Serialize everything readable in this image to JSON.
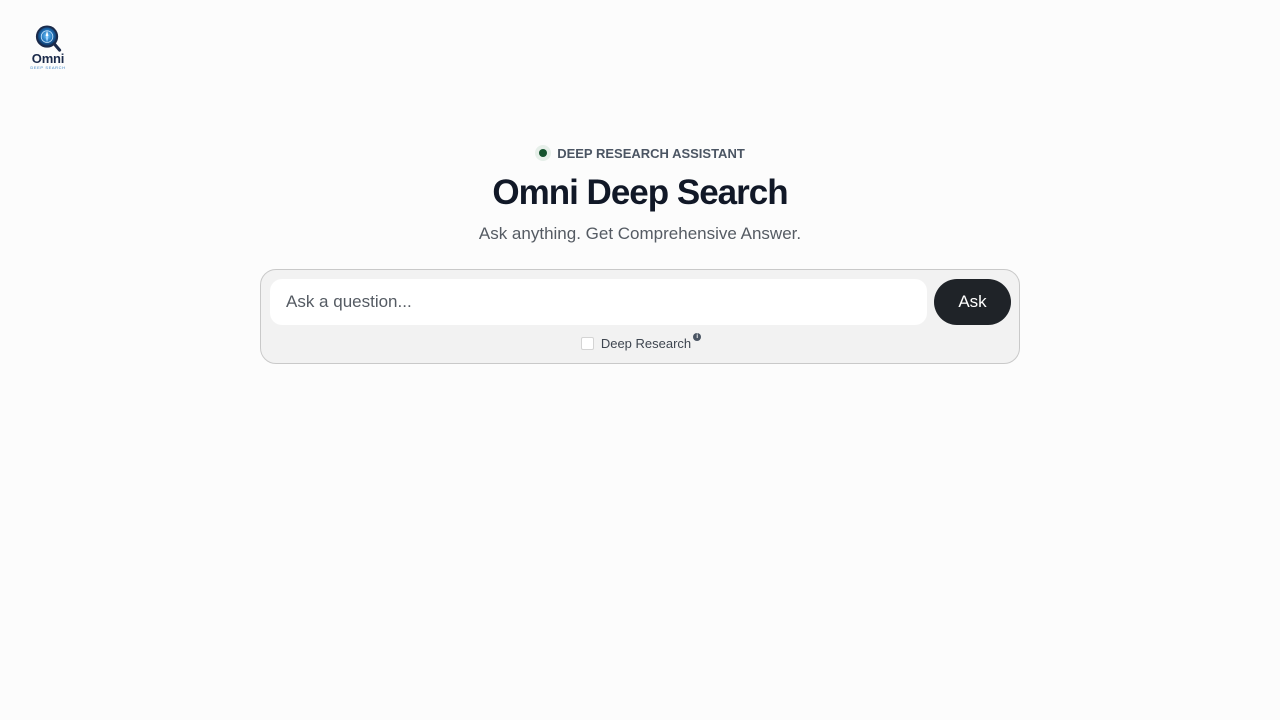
{
  "brand": {
    "logo_word": "Omni",
    "logo_sub": "DEEP SEARCH",
    "logo_icon": "magnifier-compass-icon",
    "colors": {
      "navy": "#1b2a4a",
      "blue": "#3b82c4"
    }
  },
  "hero": {
    "badge": "DEEP RESEARCH ASSISTANT",
    "badge_dot_color": "#14532d",
    "title": "Omni Deep Search",
    "subtitle": "Ask anything. Get Comprehensive Answer."
  },
  "search": {
    "placeholder": "Ask a question...",
    "value": "",
    "ask_label": "Ask",
    "deep_research_label": "Deep Research",
    "deep_research_checked": false,
    "info_icon": "info-icon",
    "info_glyph": "i"
  }
}
